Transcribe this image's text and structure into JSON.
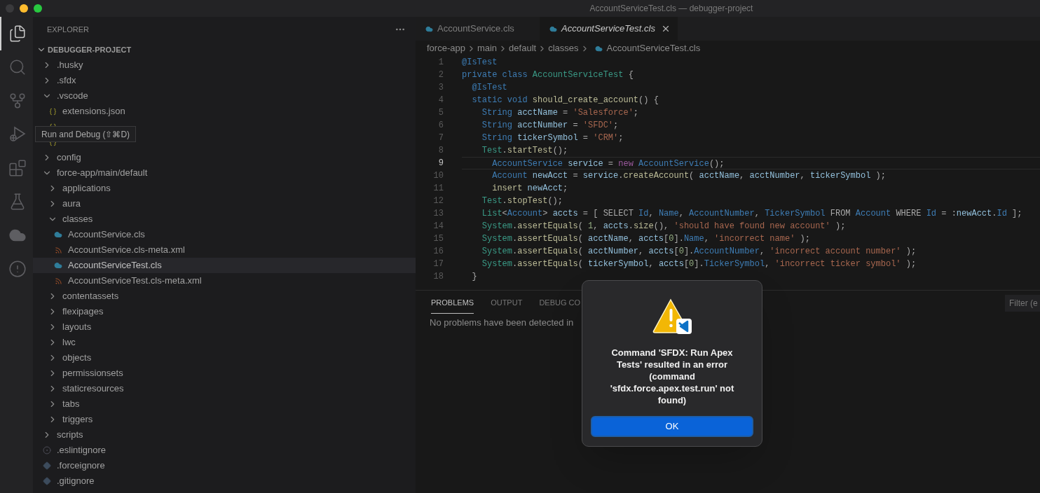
{
  "window": {
    "title": "AccountServiceTest.cls — debugger-project"
  },
  "activity_bar": [
    {
      "kind": "files",
      "selected": true
    },
    {
      "kind": "search",
      "selected": false
    },
    {
      "kind": "source-control",
      "selected": false
    },
    {
      "kind": "run-debug",
      "selected": false
    },
    {
      "kind": "extensions",
      "selected": false
    },
    {
      "kind": "testing",
      "selected": false
    },
    {
      "kind": "salesforce",
      "selected": false
    },
    {
      "kind": "problems",
      "selected": false
    }
  ],
  "tooltip": {
    "text": "Run and Debug (⇧⌘D)"
  },
  "explorer": {
    "title": "EXPLORER",
    "root": {
      "label": "DEBUGGER-PROJECT",
      "expanded": true
    },
    "items": [
      {
        "label": ".husky",
        "kind": "folder",
        "expanded": false,
        "selected": false
      },
      {
        "label": ".sfdx",
        "kind": "folder",
        "expanded": false,
        "selected": false
      },
      {
        "label": ".vscode",
        "kind": "folder",
        "expanded": true,
        "selected": false,
        "children": [
          {
            "label": "extensions.json",
            "kind": "json",
            "selected": false
          },
          {
            "kind": "json",
            "selected": false
          },
          {
            "kind": "json",
            "selected": false
          }
        ]
      },
      {
        "label": "config",
        "kind": "folder",
        "expanded": false,
        "selected": false
      },
      {
        "label": "force-app/main/default",
        "kind": "folder",
        "expanded": true,
        "selected": false,
        "children": [
          {
            "label": "applications",
            "kind": "folder",
            "expanded": false,
            "selected": false
          },
          {
            "label": "aura",
            "kind": "folder",
            "expanded": false,
            "selected": false
          },
          {
            "label": "classes",
            "kind": "folder",
            "expanded": true,
            "selected": false,
            "children": [
              {
                "label": "AccountService.cls",
                "kind": "apex",
                "selected": false
              },
              {
                "label": "AccountService.cls-meta.xml",
                "kind": "xml",
                "selected": false
              },
              {
                "label": "AccountServiceTest.cls",
                "kind": "apex",
                "selected": true
              },
              {
                "label": "AccountServiceTest.cls-meta.xml",
                "kind": "xml",
                "selected": false
              }
            ]
          },
          {
            "label": "contentassets",
            "kind": "folder",
            "expanded": false,
            "selected": false
          },
          {
            "label": "flexipages",
            "kind": "folder",
            "expanded": false,
            "selected": false
          },
          {
            "label": "layouts",
            "kind": "folder",
            "expanded": false,
            "selected": false
          },
          {
            "label": "lwc",
            "kind": "folder",
            "expanded": false,
            "selected": false
          },
          {
            "label": "objects",
            "kind": "folder",
            "expanded": false,
            "selected": false
          },
          {
            "label": "permissionsets",
            "kind": "folder",
            "expanded": false,
            "selected": false
          },
          {
            "label": "staticresources",
            "kind": "folder",
            "expanded": false,
            "selected": false
          },
          {
            "label": "tabs",
            "kind": "folder",
            "expanded": false,
            "selected": false
          },
          {
            "label": "triggers",
            "kind": "folder",
            "expanded": false,
            "selected": false
          }
        ]
      },
      {
        "label": "scripts",
        "kind": "folder",
        "expanded": false,
        "selected": false
      },
      {
        "label": ".eslintignore",
        "kind": "config",
        "selected": false
      },
      {
        "label": ".forceignore",
        "kind": "ignore",
        "selected": false
      },
      {
        "label": ".gitignore",
        "kind": "ignore",
        "selected": false
      }
    ]
  },
  "tabs": [
    {
      "label": "AccountService.cls",
      "selected": false,
      "preview": false
    },
    {
      "label": "AccountServiceTest.cls",
      "selected": true,
      "preview": true
    }
  ],
  "breadcrumb": [
    {
      "label": "force-app",
      "kind": "folder"
    },
    {
      "label": "main",
      "kind": "folder"
    },
    {
      "label": "default",
      "kind": "folder"
    },
    {
      "label": "classes",
      "kind": "folder"
    },
    {
      "label": "AccountServiceTest.cls",
      "kind": "apex"
    }
  ],
  "code": {
    "lines": [
      {
        "number": "1",
        "current": false,
        "tokens": [
          {
            "text": "@IsTest",
            "kind": "annotation"
          }
        ]
      },
      {
        "number": "2",
        "current": false,
        "tokens": [
          {
            "text": "private class",
            "kind": "keyword"
          },
          {
            "text": " AccountServiceTest",
            "kind": "class"
          },
          {
            "text": " {",
            "kind": "plain"
          }
        ]
      },
      {
        "number": "3",
        "current": false,
        "tokens": [
          {
            "text": "  @IsTest",
            "kind": "annotation"
          }
        ]
      },
      {
        "number": "4",
        "current": false,
        "tokens": [
          {
            "text": "  static void",
            "kind": "keyword"
          },
          {
            "text": " should_create_account",
            "kind": "function"
          },
          {
            "text": "() {",
            "kind": "plain"
          }
        ]
      },
      {
        "number": "5",
        "current": false,
        "tokens": [
          {
            "text": "    String",
            "kind": "keyword"
          },
          {
            "text": " acctName",
            "kind": "variable"
          },
          {
            "text": " = ",
            "kind": "plain"
          },
          {
            "text": "'Salesforce'",
            "kind": "string"
          },
          {
            "text": ";",
            "kind": "plain"
          }
        ]
      },
      {
        "number": "6",
        "current": false,
        "tokens": [
          {
            "text": "    String",
            "kind": "keyword"
          },
          {
            "text": " acctNumber",
            "kind": "variable"
          },
          {
            "text": " = ",
            "kind": "plain"
          },
          {
            "text": "'SFDC'",
            "kind": "string"
          },
          {
            "text": ";",
            "kind": "plain"
          }
        ]
      },
      {
        "number": "7",
        "current": false,
        "tokens": [
          {
            "text": "    String",
            "kind": "keyword"
          },
          {
            "text": " tickerSymbol",
            "kind": "variable"
          },
          {
            "text": " = ",
            "kind": "plain"
          },
          {
            "text": "'CRM'",
            "kind": "string"
          },
          {
            "text": ";",
            "kind": "plain"
          }
        ]
      },
      {
        "number": "8",
        "current": false,
        "tokens": [
          {
            "text": "    Test",
            "kind": "class"
          },
          {
            "text": ".",
            "kind": "plain"
          },
          {
            "text": "startTest",
            "kind": "function"
          },
          {
            "text": "();",
            "kind": "plain"
          }
        ]
      },
      {
        "number": "9",
        "current": true,
        "tokens": [
          {
            "text": "      AccountService",
            "kind": "keyword"
          },
          {
            "text": " service",
            "kind": "variable"
          },
          {
            "text": " = ",
            "kind": "plain"
          },
          {
            "text": "new",
            "kind": "new"
          },
          {
            "text": " AccountService",
            "kind": "keyword"
          },
          {
            "text": "();",
            "kind": "plain"
          }
        ]
      },
      {
        "number": "10",
        "current": false,
        "tokens": [
          {
            "text": "      Account",
            "kind": "keyword"
          },
          {
            "text": " newAcct",
            "kind": "variable"
          },
          {
            "text": " = ",
            "kind": "plain"
          },
          {
            "text": "service",
            "kind": "variable"
          },
          {
            "text": ".",
            "kind": "plain"
          },
          {
            "text": "createAccount",
            "kind": "function"
          },
          {
            "text": "( ",
            "kind": "plain"
          },
          {
            "text": "acctName",
            "kind": "variable"
          },
          {
            "text": ", ",
            "kind": "plain"
          },
          {
            "text": "acctNumber",
            "kind": "variable"
          },
          {
            "text": ", ",
            "kind": "plain"
          },
          {
            "text": "tickerSymbol",
            "kind": "variable"
          },
          {
            "text": " );",
            "kind": "plain"
          }
        ]
      },
      {
        "number": "11",
        "current": false,
        "tokens": [
          {
            "text": "      insert",
            "kind": "function"
          },
          {
            "text": " newAcct",
            "kind": "variable"
          },
          {
            "text": ";",
            "kind": "plain"
          }
        ]
      },
      {
        "number": "12",
        "current": false,
        "tokens": [
          {
            "text": "    Test",
            "kind": "class"
          },
          {
            "text": ".",
            "kind": "plain"
          },
          {
            "text": "stopTest",
            "kind": "function"
          },
          {
            "text": "();",
            "kind": "plain"
          }
        ]
      },
      {
        "number": "13",
        "current": false,
        "tokens": [
          {
            "text": "    List",
            "kind": "class"
          },
          {
            "text": "<",
            "kind": "plain"
          },
          {
            "text": "Account",
            "kind": "keyword"
          },
          {
            "text": "> ",
            "kind": "plain"
          },
          {
            "text": "accts",
            "kind": "variable"
          },
          {
            "text": " = [ SELECT ",
            "kind": "plain"
          },
          {
            "text": "Id",
            "kind": "keyword"
          },
          {
            "text": ", ",
            "kind": "plain"
          },
          {
            "text": "Name",
            "kind": "keyword"
          },
          {
            "text": ", ",
            "kind": "plain"
          },
          {
            "text": "AccountNumber",
            "kind": "keyword"
          },
          {
            "text": ", ",
            "kind": "plain"
          },
          {
            "text": "TickerSymbol",
            "kind": "keyword"
          },
          {
            "text": " FROM ",
            "kind": "plain"
          },
          {
            "text": "Account",
            "kind": "keyword"
          },
          {
            "text": " WHERE ",
            "kind": "plain"
          },
          {
            "text": "Id",
            "kind": "keyword"
          },
          {
            "text": " = :",
            "kind": "plain"
          },
          {
            "text": "newAcct",
            "kind": "variable"
          },
          {
            "text": ".",
            "kind": "plain"
          },
          {
            "text": "Id",
            "kind": "keyword"
          },
          {
            "text": " ];",
            "kind": "plain"
          }
        ]
      },
      {
        "number": "14",
        "current": false,
        "tokens": [
          {
            "text": "    System",
            "kind": "class"
          },
          {
            "text": ".",
            "kind": "plain"
          },
          {
            "text": "assertEquals",
            "kind": "function"
          },
          {
            "text": "( ",
            "kind": "plain"
          },
          {
            "text": "1",
            "kind": "number"
          },
          {
            "text": ", ",
            "kind": "plain"
          },
          {
            "text": "accts",
            "kind": "variable"
          },
          {
            "text": ".",
            "kind": "plain"
          },
          {
            "text": "size",
            "kind": "function"
          },
          {
            "text": "(), ",
            "kind": "plain"
          },
          {
            "text": "'should have found new account'",
            "kind": "string"
          },
          {
            "text": " );",
            "kind": "plain"
          }
        ]
      },
      {
        "number": "15",
        "current": false,
        "tokens": [
          {
            "text": "    System",
            "kind": "class"
          },
          {
            "text": ".",
            "kind": "plain"
          },
          {
            "text": "assertEquals",
            "kind": "function"
          },
          {
            "text": "( ",
            "kind": "plain"
          },
          {
            "text": "acctName",
            "kind": "variable"
          },
          {
            "text": ", ",
            "kind": "plain"
          },
          {
            "text": "accts",
            "kind": "variable"
          },
          {
            "text": "[",
            "kind": "plain"
          },
          {
            "text": "0",
            "kind": "number"
          },
          {
            "text": "].",
            "kind": "plain"
          },
          {
            "text": "Name",
            "kind": "keyword"
          },
          {
            "text": ", ",
            "kind": "plain"
          },
          {
            "text": "'incorrect name'",
            "kind": "string"
          },
          {
            "text": " );",
            "kind": "plain"
          }
        ]
      },
      {
        "number": "16",
        "current": false,
        "tokens": [
          {
            "text": "    System",
            "kind": "class"
          },
          {
            "text": ".",
            "kind": "plain"
          },
          {
            "text": "assertEquals",
            "kind": "function"
          },
          {
            "text": "( ",
            "kind": "plain"
          },
          {
            "text": "acctNumber",
            "kind": "variable"
          },
          {
            "text": ", ",
            "kind": "plain"
          },
          {
            "text": "accts",
            "kind": "variable"
          },
          {
            "text": "[",
            "kind": "plain"
          },
          {
            "text": "0",
            "kind": "number"
          },
          {
            "text": "].",
            "kind": "plain"
          },
          {
            "text": "AccountNumber",
            "kind": "keyword"
          },
          {
            "text": ", ",
            "kind": "plain"
          },
          {
            "text": "'incorrect account number'",
            "kind": "string"
          },
          {
            "text": " );",
            "kind": "plain"
          }
        ]
      },
      {
        "number": "17",
        "current": false,
        "tokens": [
          {
            "text": "    System",
            "kind": "class"
          },
          {
            "text": ".",
            "kind": "plain"
          },
          {
            "text": "assertEquals",
            "kind": "function"
          },
          {
            "text": "( ",
            "kind": "plain"
          },
          {
            "text": "tickerSymbol",
            "kind": "variable"
          },
          {
            "text": ", ",
            "kind": "plain"
          },
          {
            "text": "accts",
            "kind": "variable"
          },
          {
            "text": "[",
            "kind": "plain"
          },
          {
            "text": "0",
            "kind": "number"
          },
          {
            "text": "].",
            "kind": "plain"
          },
          {
            "text": "TickerSymbol",
            "kind": "keyword"
          },
          {
            "text": ", ",
            "kind": "plain"
          },
          {
            "text": "'incorrect ticker symbol'",
            "kind": "string"
          },
          {
            "text": " );",
            "kind": "plain"
          }
        ]
      },
      {
        "number": "18",
        "current": false,
        "tokens": [
          {
            "text": "  }",
            "kind": "plain"
          }
        ]
      }
    ]
  },
  "panel": {
    "tabs": [
      {
        "label": "PROBLEMS",
        "selected": true
      },
      {
        "label": "OUTPUT",
        "selected": false
      },
      {
        "label": "DEBUG CO",
        "selected": false
      }
    ],
    "message": "No problems have been detected in",
    "filter": {
      "placeholder": "Filter (e"
    }
  },
  "dialog": {
    "message": "Command 'SFDX: Run Apex Tests' resulted in an error (command 'sfdx.force.apex.test.run' not found)",
    "button": "OK"
  }
}
